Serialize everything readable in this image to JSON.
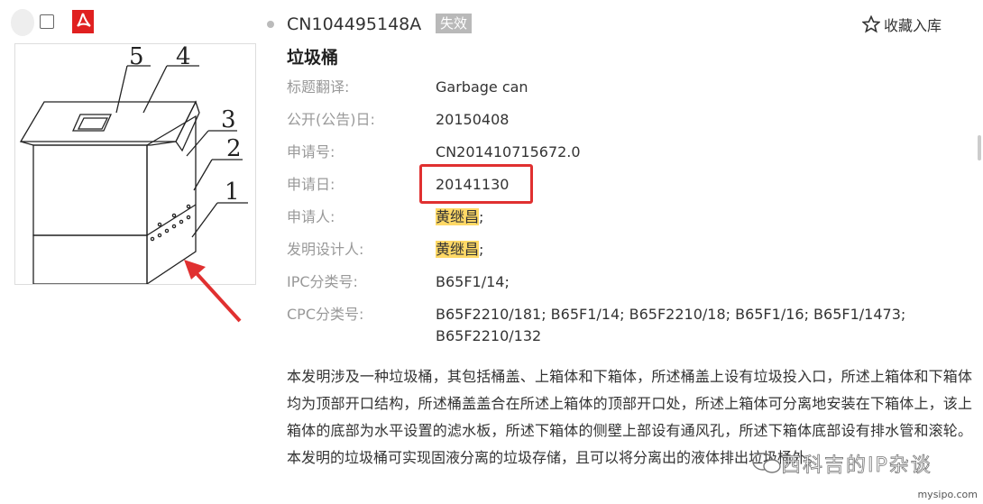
{
  "record": {
    "pub_number": "CN104495148A",
    "status": "失效",
    "favorite_label": "收藏入库",
    "title": "垃圾桶"
  },
  "fields": [
    {
      "label": "标题翻译:",
      "value": "Garbage can"
    },
    {
      "label": "公开(公告)日:",
      "value": "20150408"
    },
    {
      "label": "申请号:",
      "value": "CN201410715672.0"
    },
    {
      "label": "申请日:",
      "value": "20141130"
    },
    {
      "label": "申请人:",
      "value": "黄继昌",
      "suffix": ";"
    },
    {
      "label": "发明设计人:",
      "value": "黄继昌",
      "suffix": ";"
    },
    {
      "label": "IPC分类号:",
      "value": "B65F1/14;"
    },
    {
      "label": "CPC分类号:",
      "value": "B65F2210/181; B65F1/14; B65F2210/18; B65F1/16; B65F1/1473; B65F2210/132"
    }
  ],
  "abstract": "本发明涉及一种垃圾桶，其包括桶盖、上箱体和下箱体，所述桶盖上设有垃圾投入口，所述上箱体和下箱体均为顶部开口结构，所述桶盖盖合在所述上箱体的顶部开口处，所述上箱体可分离地安装在下箱体上，该上箱体的底部为水平设置的滤水板，所述下箱体的侧壁上部设有通风孔，所述下箱体底部设有排水管和滚轮。本发明的垃圾桶可实现固液分离的垃圾存储，且可以将分离出的液体排出垃圾桶外。",
  "drawing_labels": [
    "5",
    "4",
    "3",
    "2",
    "1"
  ],
  "watermark": "西科吉的IP杂谈",
  "site": "mysipo.com",
  "icons": {
    "pdf": "pdf-icon",
    "star": "star-outline-icon",
    "wechat": "wechat-icon"
  },
  "colors": {
    "highlight": "#ffd966",
    "annotation_red": "#e03030",
    "status_bg": "#b9b9b9"
  }
}
